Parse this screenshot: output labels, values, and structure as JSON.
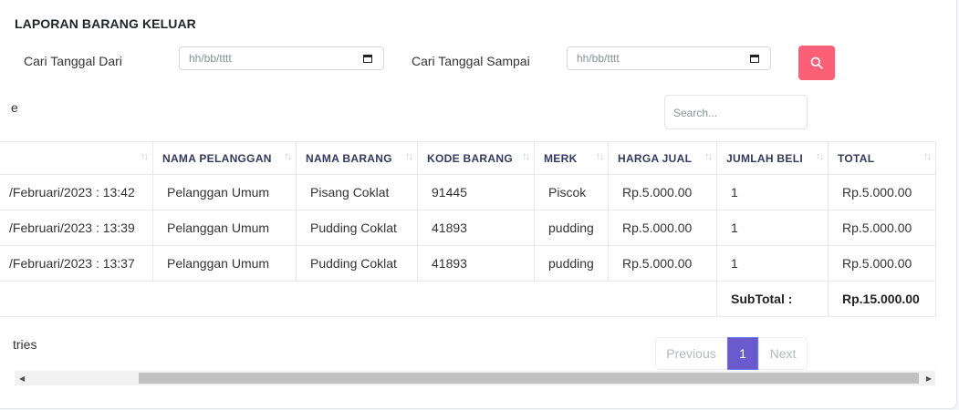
{
  "page": {
    "title": "LAPORAN BARANG KELUAR"
  },
  "filter": {
    "from_label": "Cari Tanggal Dari",
    "from_placeholder": "hh/bb/tttt",
    "to_label": "Cari Tanggal Sampai",
    "to_placeholder": "hh/bb/tttt",
    "search_icon": "search-icon",
    "button_color": "#fc6076"
  },
  "datatable": {
    "length_label_fragment": "e",
    "search_placeholder": "Search...",
    "info_fragment": "tries",
    "columns": [
      "",
      "NAMA PELANGGAN",
      "NAMA BARANG",
      "KODE BARANG",
      "MERK",
      "HARGA JUAL",
      "JUMLAH BELI",
      "TOTAL"
    ],
    "rows": [
      [
        "/Februari/2023 : 13:42",
        "Pelanggan Umum",
        "Pisang Coklat",
        "91445",
        "Piscok",
        "Rp.5.000.00",
        "1",
        "Rp.5.000.00"
      ],
      [
        "/Februari/2023 : 13:39",
        "Pelanggan Umum",
        "Pudding Coklat",
        "41893",
        "pudding",
        "Rp.5.000.00",
        "1",
        "Rp.5.000.00"
      ],
      [
        "/Februari/2023 : 13:37",
        "Pelanggan Umum",
        "Pudding Coklat",
        "41893",
        "pudding",
        "Rp.5.000.00",
        "1",
        "Rp.5.000.00"
      ]
    ],
    "subtotal_label": "SubTotal :",
    "subtotal_value": "Rp.15.000.00",
    "pagination": {
      "previous": "Previous",
      "current": "1",
      "next": "Next"
    },
    "active_page_color": "#6a5acd"
  }
}
